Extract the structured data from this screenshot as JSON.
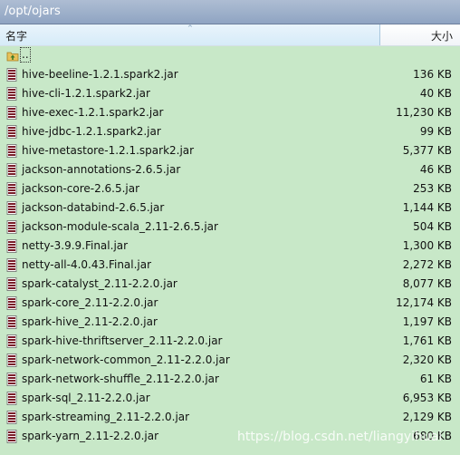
{
  "path_bar": {
    "path": "/opt/ojars"
  },
  "columns": {
    "name": "名字",
    "size": "大小",
    "sort_indicator": "^"
  },
  "parent_entry": {
    "label": "..",
    "icon": "folder-up-icon"
  },
  "files": [
    {
      "name": "hive-beeline-1.2.1.spark2.jar",
      "size": "136 KB"
    },
    {
      "name": "hive-cli-1.2.1.spark2.jar",
      "size": "40 KB"
    },
    {
      "name": "hive-exec-1.2.1.spark2.jar",
      "size": "11,230 KB"
    },
    {
      "name": "hive-jdbc-1.2.1.spark2.jar",
      "size": "99 KB"
    },
    {
      "name": "hive-metastore-1.2.1.spark2.jar",
      "size": "5,377 KB"
    },
    {
      "name": "jackson-annotations-2.6.5.jar",
      "size": "46 KB"
    },
    {
      "name": "jackson-core-2.6.5.jar",
      "size": "253 KB"
    },
    {
      "name": "jackson-databind-2.6.5.jar",
      "size": "1,144 KB"
    },
    {
      "name": "jackson-module-scala_2.11-2.6.5.jar",
      "size": "504 KB"
    },
    {
      "name": "netty-3.9.9.Final.jar",
      "size": "1,300 KB"
    },
    {
      "name": "netty-all-4.0.43.Final.jar",
      "size": "2,272 KB"
    },
    {
      "name": "spark-catalyst_2.11-2.2.0.jar",
      "size": "8,077 KB"
    },
    {
      "name": "spark-core_2.11-2.2.0.jar",
      "size": "12,174 KB"
    },
    {
      "name": "spark-hive_2.11-2.2.0.jar",
      "size": "1,197 KB"
    },
    {
      "name": "spark-hive-thriftserver_2.11-2.2.0.jar",
      "size": "1,761 KB"
    },
    {
      "name": "spark-network-common_2.11-2.2.0.jar",
      "size": "2,320 KB"
    },
    {
      "name": "spark-network-shuffle_2.11-2.2.0.jar",
      "size": "61 KB"
    },
    {
      "name": "spark-sql_2.11-2.2.0.jar",
      "size": "6,953 KB"
    },
    {
      "name": "spark-streaming_2.11-2.2.0.jar",
      "size": "2,129 KB"
    },
    {
      "name": "spark-yarn_2.11-2.2.0.jar",
      "size": "680 KB"
    }
  ],
  "watermark": "https://blog.csdn.net/liangyihuai",
  "colors": {
    "list_background": "#c8e8c8",
    "path_bar": "#9fb2cc",
    "header_selected": "#d6ebf8"
  },
  "file_icon": "jar-file-icon"
}
